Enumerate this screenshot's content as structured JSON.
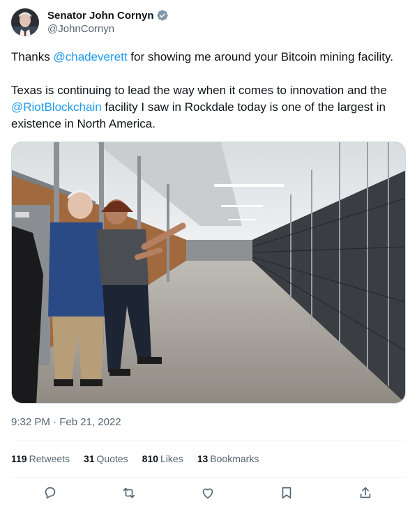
{
  "author": {
    "display_name": "Senator John Cornyn",
    "handle": "@JohnCornyn",
    "verified_icon": "verified-badge-icon"
  },
  "tweet": {
    "para1_prefix": "Thanks ",
    "para1_mention": "@chadeverett",
    "para1_suffix": " for showing me around your Bitcoin mining facility.",
    "para2_prefix": "Texas is continuing to lead the way when it comes to innovation and the ",
    "para2_mention": "@RiotBlockchain",
    "para2_suffix": " facility I saw in Rockdale today is one of the largest in existence in North America."
  },
  "timestamp": {
    "time": "9:32 PM",
    "separator": " · ",
    "date": "Feb 21, 2022"
  },
  "stats": [
    {
      "count": "119",
      "label": "Retweets"
    },
    {
      "count": "31",
      "label": "Quotes"
    },
    {
      "count": "810",
      "label": "Likes"
    },
    {
      "count": "13",
      "label": "Bookmarks"
    }
  ],
  "actions": [
    {
      "name": "reply-icon"
    },
    {
      "name": "retweet-icon"
    },
    {
      "name": "like-icon"
    },
    {
      "name": "bookmark-icon"
    },
    {
      "name": "share-icon"
    }
  ],
  "colors": {
    "link": "#1d9bf0",
    "secondary_text": "#536471",
    "divider": "#eff3f4",
    "verified": "#829aab"
  }
}
